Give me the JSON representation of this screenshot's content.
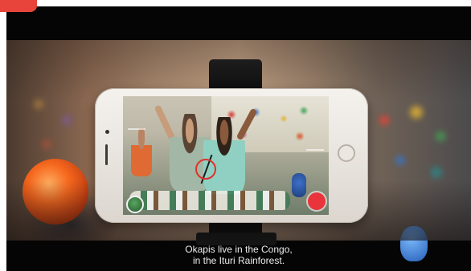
{
  "video": {
    "subtitle_line_1": "Okapis live in the Congo,",
    "subtitle_line_2": "in the Ituri Rainforest."
  },
  "colors": {
    "accent_tab": "#e8443c",
    "record_button": "#e8343a",
    "letterbox": "#050505"
  },
  "icons": {
    "record": "record-circle",
    "home": "home-button",
    "target": "focus-ring"
  }
}
